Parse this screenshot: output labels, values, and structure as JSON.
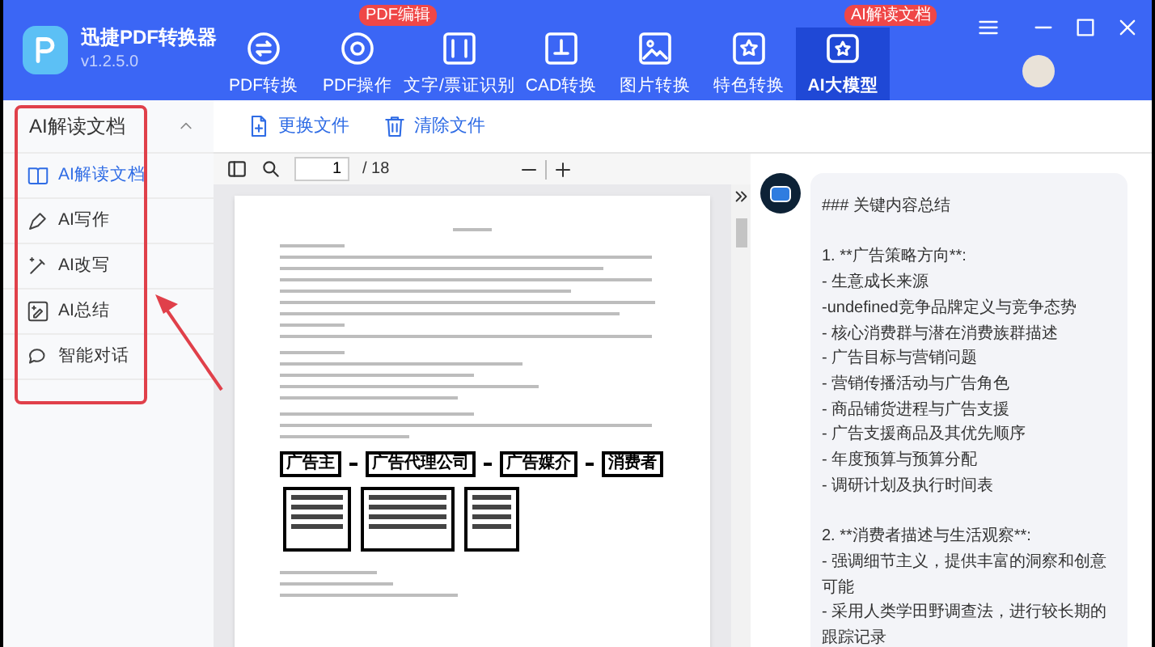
{
  "app": {
    "name": "迅捷PDF转换器",
    "version": "v1.2.5.0"
  },
  "nav": [
    {
      "label": "PDF转换",
      "selected": false
    },
    {
      "label": "PDF操作",
      "selected": false,
      "badge": "PDF编辑"
    },
    {
      "label": "文字/票证识别",
      "selected": false
    },
    {
      "label": "CAD转换",
      "selected": false
    },
    {
      "label": "图片转换",
      "selected": false
    },
    {
      "label": "特色转换",
      "selected": false
    },
    {
      "label": "AI大模型",
      "selected": true,
      "badge": "AI解读文档"
    }
  ],
  "sidebar": {
    "title": "AI解读文档",
    "expanded": true,
    "items": [
      {
        "label": "AI解读文档",
        "selected": true
      },
      {
        "label": "AI写作",
        "selected": false
      },
      {
        "label": "AI改写",
        "selected": false
      },
      {
        "label": "AI总结",
        "selected": false
      },
      {
        "label": "智能对话",
        "selected": false
      }
    ]
  },
  "file_toolbar": [
    "更换文件",
    "清除文件"
  ],
  "viewer": {
    "page": "1",
    "total": "/ 18"
  },
  "document": {
    "flowchart": [
      "广告主",
      "广告代理公司",
      "广告媒介",
      "消费者"
    ]
  },
  "chat": {
    "paragraphs": [
      [
        "### 关键内容总结"
      ],
      [
        "1. **广告策略方向**:",
        "- 生意成长来源",
        "-undefined竞争品牌定义与竞争态势",
        "- 核心消费群与潜在消费族群描述",
        "- 广告目标与营销问题",
        "- 营销传播活动与广告角色",
        "- 商品铺货进程与广告支援",
        "- 广告支援商品及其优先顺序",
        "- 年度预算与预算分配",
        "- 调研计划及执行时间表"
      ],
      [
        "2. **消费者描述与生活观察**:",
        "- 强调细节主义，提供丰富的洞察和创意可能",
        "- 采用人类学田野调查法，进行较长期的跟踪记录"
      ]
    ]
  }
}
